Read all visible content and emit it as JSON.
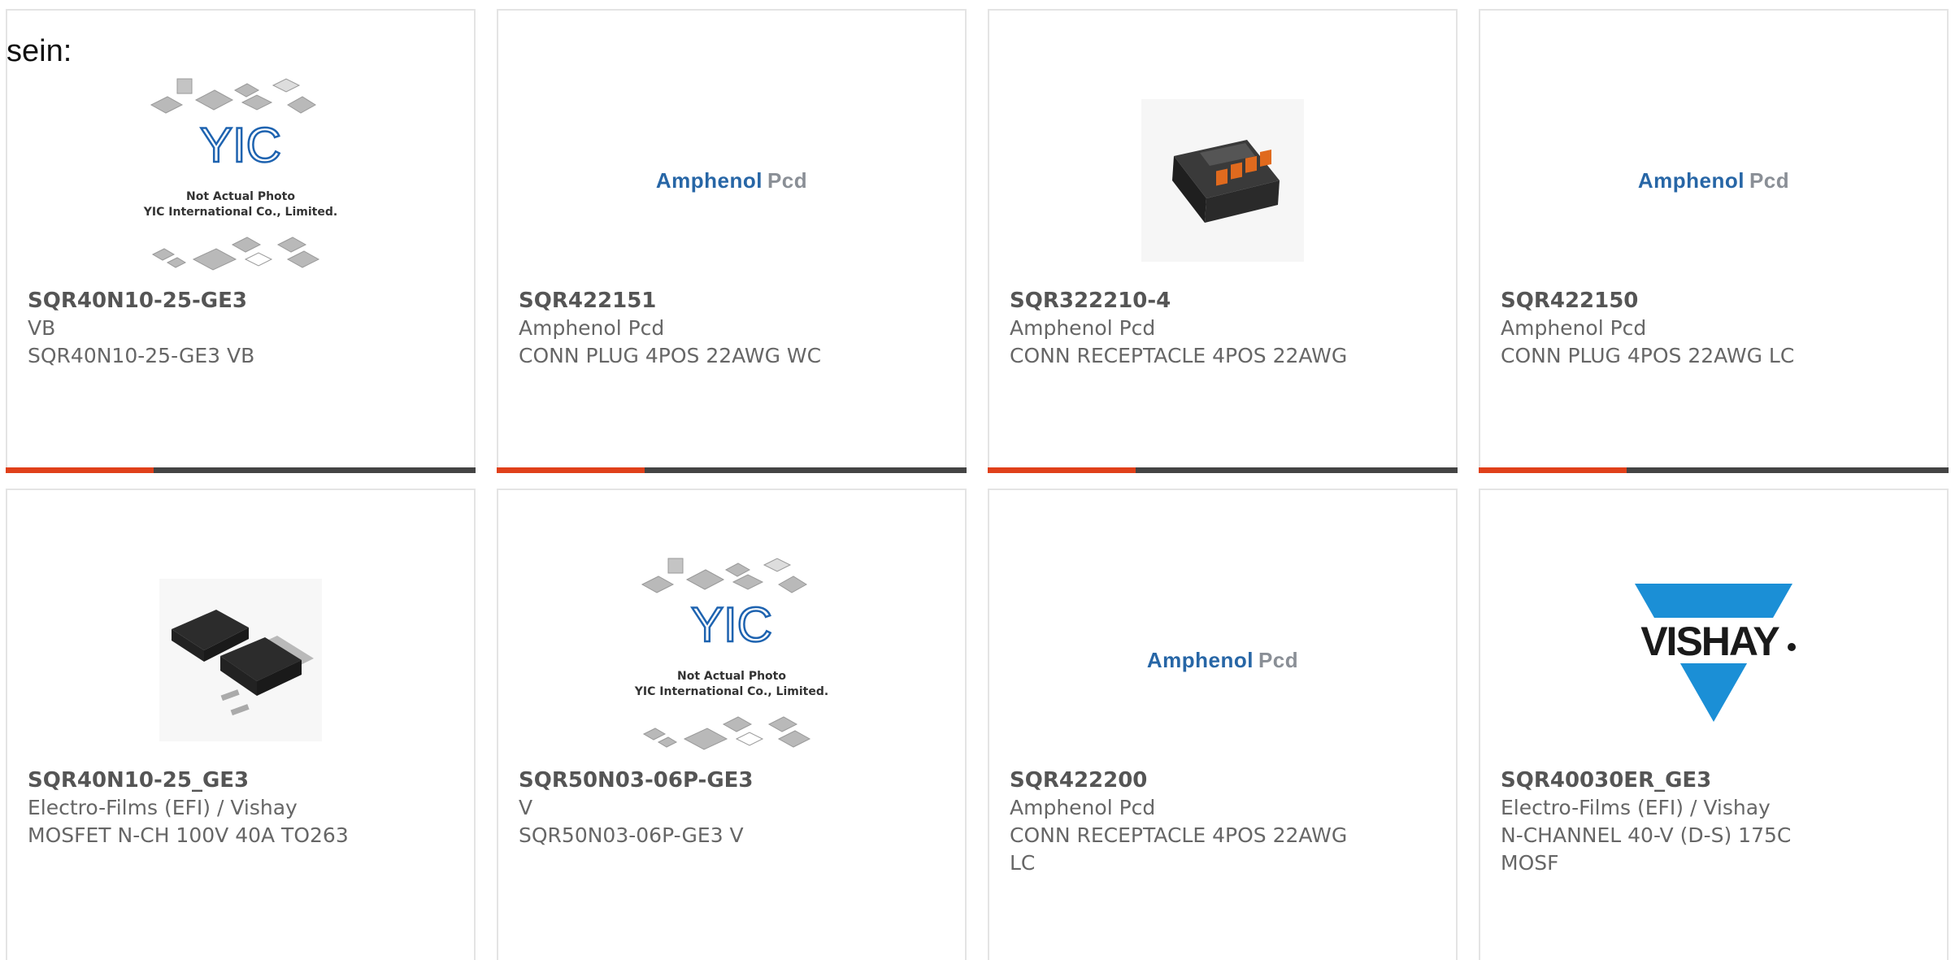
{
  "page": {
    "label": "sein:"
  },
  "brands": {
    "amphenol_a": "Amphenol",
    "amphenol_b": "Pcd",
    "vishay": "VISHAY",
    "yic_logo": "YIC",
    "yic_note_1": "Not Actual Photo",
    "yic_note_2": "YIC International Co., Limited."
  },
  "colors": {
    "accent": "#e0401a",
    "bar": "#444444",
    "amphenol_blue": "#2766a6",
    "vishay_blue": "#1b8fd6"
  },
  "products": [
    {
      "part": "SQR40N10-25-GE3",
      "maker": "VB",
      "desc": "SQR40N10-25-GE3 VB",
      "image": "yic-placeholder"
    },
    {
      "part": "SQR422151",
      "maker": "Amphenol Pcd",
      "desc": "CONN PLUG 4POS 22AWG WC",
      "image": "amphenol-logo"
    },
    {
      "part": "SQR322210-4",
      "maker": "Amphenol Pcd",
      "desc": "CONN RECEPTACLE 4POS 22AWG",
      "image": "connector-photo"
    },
    {
      "part": "SQR422150",
      "maker": "Amphenol Pcd",
      "desc": "CONN PLUG 4POS 22AWG LC",
      "image": "amphenol-logo"
    },
    {
      "part": "SQR40N10-25_GE3",
      "maker": "Electro-Films (EFI) / Vishay",
      "desc": "MOSFET N-CH 100V 40A TO263",
      "image": "to263-photo"
    },
    {
      "part": "SQR50N03-06P-GE3",
      "maker": "V",
      "desc": "SQR50N03-06P-GE3 V",
      "image": "yic-placeholder"
    },
    {
      "part": "SQR422200",
      "maker": "Amphenol Pcd",
      "desc": "CONN RECEPTACLE 4POS 22AWG LC",
      "image": "amphenol-logo"
    },
    {
      "part": "SQR40030ER_GE3",
      "maker": "Electro-Films (EFI) / Vishay",
      "desc": "N-CHANNEL 40-V (D-S) 175C MOSF",
      "image": "vishay-logo"
    }
  ]
}
